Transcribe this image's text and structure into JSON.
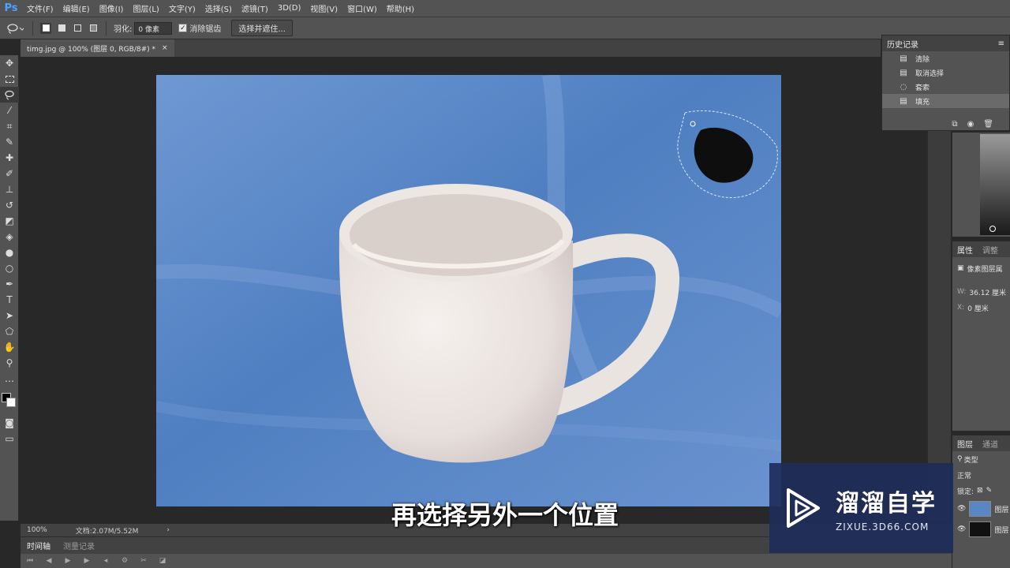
{
  "app": {
    "logo": "Ps"
  },
  "menu": [
    "文件(F)",
    "编辑(E)",
    "图像(I)",
    "图层(L)",
    "文字(Y)",
    "选择(S)",
    "滤镜(T)",
    "3D(D)",
    "视图(V)",
    "窗口(W)",
    "帮助(H)"
  ],
  "options": {
    "feather_label": "羽化:",
    "feather_value": "0 像素",
    "antialias_label": "消除锯齿",
    "antialias_checked": true,
    "select_mask_button": "选择并遮住..."
  },
  "document": {
    "tab_title": "timg.jpg @ 100% (图层 0, RGB/8#) *",
    "close": "×"
  },
  "status": {
    "zoom": "100%",
    "doc_info": "文档:2.07M/5.52M",
    "arrow": "›"
  },
  "timeline": {
    "tabs": [
      "时间轴",
      "测量记录"
    ]
  },
  "history": {
    "title": "历史记录",
    "items": [
      {
        "label": "清除",
        "icon": "document-icon"
      },
      {
        "label": "取消选择",
        "icon": "document-icon"
      },
      {
        "label": "套索",
        "icon": "lasso-icon"
      },
      {
        "label": "填充",
        "icon": "document-icon",
        "selected": true
      }
    ]
  },
  "properties": {
    "tabs": [
      "属性",
      "调整"
    ],
    "layer_type": "像素图层属",
    "w_label": "W:",
    "w_value": "36.12 厘米",
    "x_label": "X:",
    "x_value": "0 厘米"
  },
  "layers": {
    "tabs": [
      "图层",
      "通道"
    ],
    "filter": "类型",
    "blend_mode": "正常",
    "lock_label": "锁定:",
    "items": [
      {
        "name": "图层"
      },
      {
        "name": "图层"
      }
    ]
  },
  "watermark": {
    "title": "溜溜自学",
    "url": "ZIXUE.3D66.COM"
  },
  "subtitle": "再选择另外一个位置",
  "colors": {
    "canvas_blue": "#5a86c4",
    "mug_white": "#ece6e2"
  }
}
